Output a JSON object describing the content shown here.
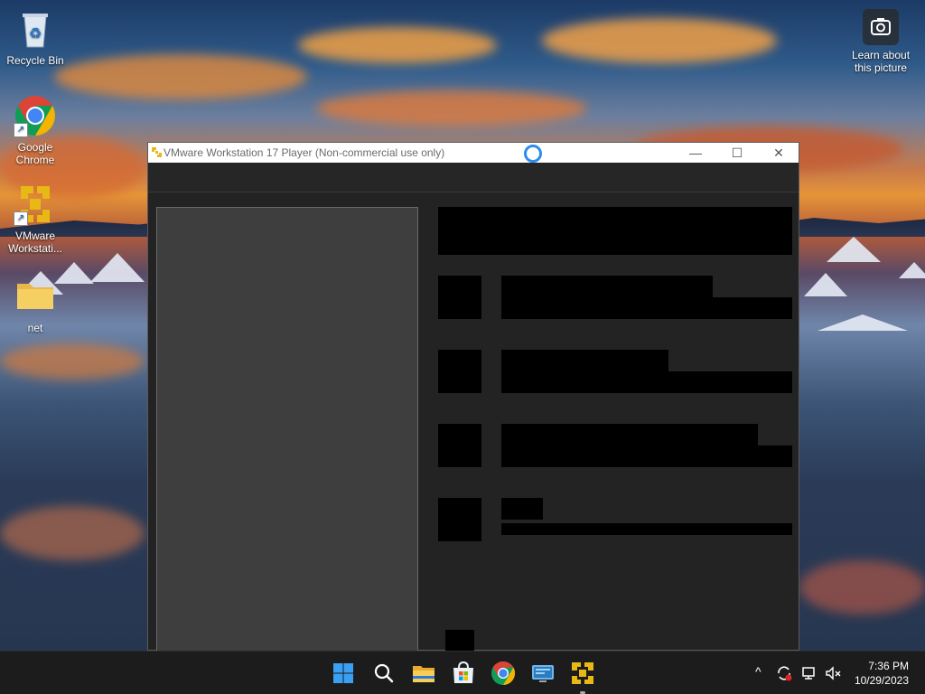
{
  "desktop": {
    "icons": [
      {
        "label": "Recycle Bin"
      },
      {
        "label": "Google Chrome"
      },
      {
        "label": "VMware Workstati..."
      },
      {
        "label": "net"
      }
    ],
    "spotlight": {
      "label": "Learn about this picture"
    }
  },
  "window": {
    "title": "VMware Workstation 17 Player (Non-commercial use only)",
    "minimize_glyph": "—",
    "maximize_glyph": "☐",
    "close_glyph": "✕"
  },
  "taskbar": {
    "apps": [
      "start-button",
      "search",
      "file-explorer",
      "microsoft-store",
      "google-chrome",
      "remote-desktop",
      "vmware-player"
    ],
    "tray": {
      "chevron": "^",
      "time": "7:36 PM",
      "date": "10/29/2023"
    }
  },
  "colors": {
    "vmware_yellow": "#e8b816",
    "chrome_red": "#db4437",
    "chrome_green": "#0f9d58",
    "chrome_yellow": "#f4b400",
    "chrome_blue": "#4285f4",
    "windows_blue": "#3aa0f3"
  }
}
